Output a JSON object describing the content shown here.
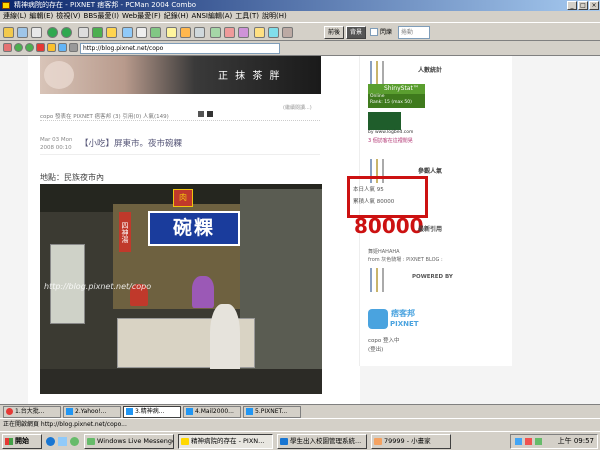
{
  "window": {
    "title": "精神病院的存在 - PIXNET 痞客邦 - PCMan 2004 Combo",
    "buttons": [
      "_",
      "□",
      "×"
    ]
  },
  "menu": [
    "連線(L)",
    "編輯(E)",
    "檢視(V)",
    "BBS最愛(I)",
    "Web最愛(F)",
    "紀錄(H)",
    "ANSI編輯(A)",
    "工具(T)",
    "說明(H)"
  ],
  "toolbar": {
    "toggle_left": "前後",
    "toggle_right": "背景",
    "checkbox_label": "閃爍",
    "dropdown": "捲動"
  },
  "address": {
    "url": "http://blog.pixnet.net/copo"
  },
  "page": {
    "banner_text": "正 抹 茶 胖",
    "post_meta_prev": "copo 發表在 PIXNET 痞客邦 (3) 引用(0) 人氣(149)",
    "post_date": "Mar 03 Mon 2008 00:10",
    "post_title": "【小吃】屏東市。夜市碗粿",
    "location": "地點：民族夜市內",
    "photo_sign_top": "碗粿",
    "photo_sign_vertical": "四神湯",
    "photo_sign_small": "肉",
    "watermark": "http://blog.pixnet.net/copo",
    "edit_link": "(繼續閱讀...)"
  },
  "sidebar": {
    "stats_title": "人數統計",
    "shinystat": "ShinyStat™",
    "shiny_online": "Online",
    "shiny_rank": "Rank: 15 (max 50)",
    "logbed": "by www.logbed.com",
    "logbed_link": "3 個訪客在這裡閒晃",
    "pop_title": "參觀人氣",
    "pop_today": "本日人氣 95",
    "pop_total": "累積人氣 80000",
    "big_number": "80000",
    "tracks_title": "最新引用",
    "track_text": "舞姬HAHAHA",
    "track_from": "from 灰色騎場 : PIXNET BLOG :",
    "powered_title": "POWERED BY",
    "pixnet_cn": "痞客邦",
    "pixnet_en": "PIXNET",
    "login_user": "copo 登入中",
    "logout": "(登出)"
  },
  "tabs": [
    "1.台大批...",
    "2.Yahoo!...",
    "3.精神病...",
    "4.Mail2000...",
    "5.PIXNET..."
  ],
  "status": "正在開啟網頁 http://blog.pixnet.net/copo...",
  "taskbar": {
    "start": "開始",
    "tasks": [
      "Windows Live Messenger",
      "精神病院的存在 - PIXN...",
      "學生出入校園管理系統...",
      "79999 - 小畫家"
    ],
    "clock": "上午 09:57"
  },
  "colors": {
    "title_start": "#0a246a",
    "title_end": "#a6caf0",
    "annotation_red": "#cc1111",
    "shiny_green": "#5a9e2f"
  }
}
